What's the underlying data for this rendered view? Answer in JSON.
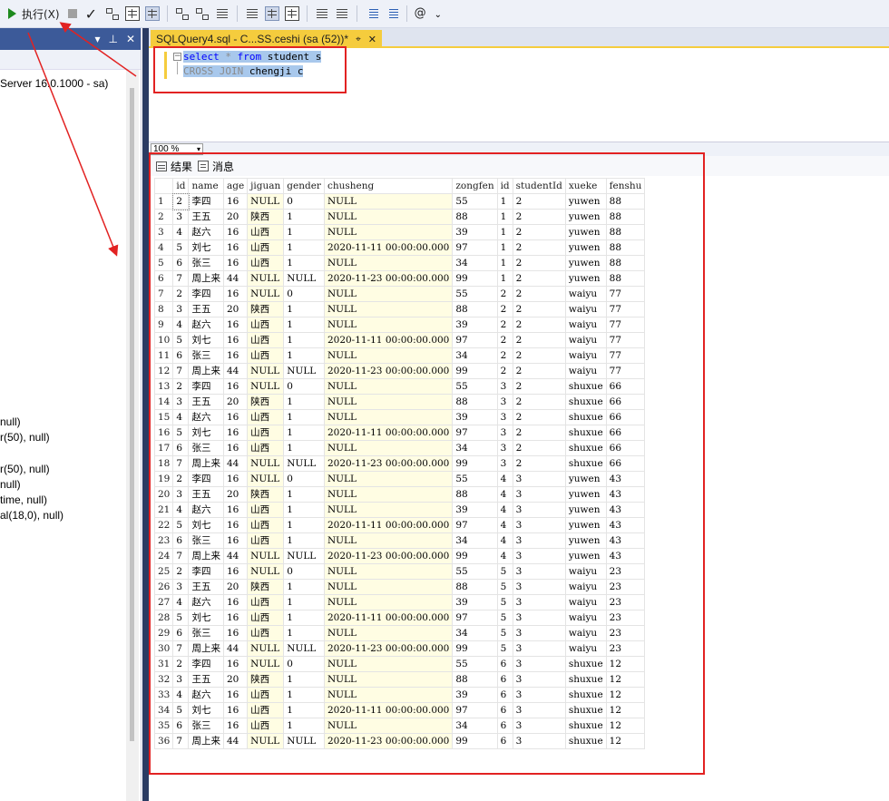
{
  "toolbar": {
    "execute_label": "执行(X)"
  },
  "left_panel": {
    "server_label": "Server 16.0.1000 - sa)",
    "column_fragments": [
      "null)",
      "r(50), null)",
      "r(50), null)",
      " null)",
      "time, null)",
      "al(18,0), null)"
    ]
  },
  "editor": {
    "tab_title": "SQLQuery4.sql - C...SS.ceshi (sa (52))*",
    "tab_pin": "⌖",
    "tab_close": "✕",
    "line1": {
      "kw1": "select",
      "star": " * ",
      "kw2": "from",
      "rest": " student s"
    },
    "line2": {
      "kw": "CROSS JOIN",
      "rest": " chengji c"
    },
    "zoom": "100 %"
  },
  "results": {
    "tab_results": "结果",
    "tab_messages": "消息",
    "columns": [
      "",
      "id",
      "name",
      "age",
      "jiguan",
      "gender",
      "chusheng",
      "zongfen",
      "id",
      "studentId",
      "xueke",
      "fenshu"
    ],
    "rows": [
      [
        "1",
        "2",
        "李四",
        "16",
        "NULL",
        "0",
        "NULL",
        "55",
        "1",
        "2",
        "yuwen",
        "88"
      ],
      [
        "2",
        "3",
        "王五",
        "20",
        "陕西",
        "1",
        "NULL",
        "88",
        "1",
        "2",
        "yuwen",
        "88"
      ],
      [
        "3",
        "4",
        "赵六",
        "16",
        "山西",
        "1",
        "NULL",
        "39",
        "1",
        "2",
        "yuwen",
        "88"
      ],
      [
        "4",
        "5",
        "刘七",
        "16",
        "山西",
        "1",
        "2020-11-11 00:00:00.000",
        "97",
        "1",
        "2",
        "yuwen",
        "88"
      ],
      [
        "5",
        "6",
        "张三",
        "16",
        "山西",
        "1",
        "NULL",
        "34",
        "1",
        "2",
        "yuwen",
        "88"
      ],
      [
        "6",
        "7",
        "周上来",
        "44",
        "NULL",
        "NULL",
        "2020-11-23 00:00:00.000",
        "99",
        "1",
        "2",
        "yuwen",
        "88"
      ],
      [
        "7",
        "2",
        "李四",
        "16",
        "NULL",
        "0",
        "NULL",
        "55",
        "2",
        "2",
        "waiyu",
        "77"
      ],
      [
        "8",
        "3",
        "王五",
        "20",
        "陕西",
        "1",
        "NULL",
        "88",
        "2",
        "2",
        "waiyu",
        "77"
      ],
      [
        "9",
        "4",
        "赵六",
        "16",
        "山西",
        "1",
        "NULL",
        "39",
        "2",
        "2",
        "waiyu",
        "77"
      ],
      [
        "10",
        "5",
        "刘七",
        "16",
        "山西",
        "1",
        "2020-11-11 00:00:00.000",
        "97",
        "2",
        "2",
        "waiyu",
        "77"
      ],
      [
        "11",
        "6",
        "张三",
        "16",
        "山西",
        "1",
        "NULL",
        "34",
        "2",
        "2",
        "waiyu",
        "77"
      ],
      [
        "12",
        "7",
        "周上来",
        "44",
        "NULL",
        "NULL",
        "2020-11-23 00:00:00.000",
        "99",
        "2",
        "2",
        "waiyu",
        "77"
      ],
      [
        "13",
        "2",
        "李四",
        "16",
        "NULL",
        "0",
        "NULL",
        "55",
        "3",
        "2",
        "shuxue",
        "66"
      ],
      [
        "14",
        "3",
        "王五",
        "20",
        "陕西",
        "1",
        "NULL",
        "88",
        "3",
        "2",
        "shuxue",
        "66"
      ],
      [
        "15",
        "4",
        "赵六",
        "16",
        "山西",
        "1",
        "NULL",
        "39",
        "3",
        "2",
        "shuxue",
        "66"
      ],
      [
        "16",
        "5",
        "刘七",
        "16",
        "山西",
        "1",
        "2020-11-11 00:00:00.000",
        "97",
        "3",
        "2",
        "shuxue",
        "66"
      ],
      [
        "17",
        "6",
        "张三",
        "16",
        "山西",
        "1",
        "NULL",
        "34",
        "3",
        "2",
        "shuxue",
        "66"
      ],
      [
        "18",
        "7",
        "周上来",
        "44",
        "NULL",
        "NULL",
        "2020-11-23 00:00:00.000",
        "99",
        "3",
        "2",
        "shuxue",
        "66"
      ],
      [
        "19",
        "2",
        "李四",
        "16",
        "NULL",
        "0",
        "NULL",
        "55",
        "4",
        "3",
        "yuwen",
        "43"
      ],
      [
        "20",
        "3",
        "王五",
        "20",
        "陕西",
        "1",
        "NULL",
        "88",
        "4",
        "3",
        "yuwen",
        "43"
      ],
      [
        "21",
        "4",
        "赵六",
        "16",
        "山西",
        "1",
        "NULL",
        "39",
        "4",
        "3",
        "yuwen",
        "43"
      ],
      [
        "22",
        "5",
        "刘七",
        "16",
        "山西",
        "1",
        "2020-11-11 00:00:00.000",
        "97",
        "4",
        "3",
        "yuwen",
        "43"
      ],
      [
        "23",
        "6",
        "张三",
        "16",
        "山西",
        "1",
        "NULL",
        "34",
        "4",
        "3",
        "yuwen",
        "43"
      ],
      [
        "24",
        "7",
        "周上来",
        "44",
        "NULL",
        "NULL",
        "2020-11-23 00:00:00.000",
        "99",
        "4",
        "3",
        "yuwen",
        "43"
      ],
      [
        "25",
        "2",
        "李四",
        "16",
        "NULL",
        "0",
        "NULL",
        "55",
        "5",
        "3",
        "waiyu",
        "23"
      ],
      [
        "26",
        "3",
        "王五",
        "20",
        "陕西",
        "1",
        "NULL",
        "88",
        "5",
        "3",
        "waiyu",
        "23"
      ],
      [
        "27",
        "4",
        "赵六",
        "16",
        "山西",
        "1",
        "NULL",
        "39",
        "5",
        "3",
        "waiyu",
        "23"
      ],
      [
        "28",
        "5",
        "刘七",
        "16",
        "山西",
        "1",
        "2020-11-11 00:00:00.000",
        "97",
        "5",
        "3",
        "waiyu",
        "23"
      ],
      [
        "29",
        "6",
        "张三",
        "16",
        "山西",
        "1",
        "NULL",
        "34",
        "5",
        "3",
        "waiyu",
        "23"
      ],
      [
        "30",
        "7",
        "周上来",
        "44",
        "NULL",
        "NULL",
        "2020-11-23 00:00:00.000",
        "99",
        "5",
        "3",
        "waiyu",
        "23"
      ],
      [
        "31",
        "2",
        "李四",
        "16",
        "NULL",
        "0",
        "NULL",
        "55",
        "6",
        "3",
        "shuxue",
        "12"
      ],
      [
        "32",
        "3",
        "王五",
        "20",
        "陕西",
        "1",
        "NULL",
        "88",
        "6",
        "3",
        "shuxue",
        "12"
      ],
      [
        "33",
        "4",
        "赵六",
        "16",
        "山西",
        "1",
        "NULL",
        "39",
        "6",
        "3",
        "shuxue",
        "12"
      ],
      [
        "34",
        "5",
        "刘七",
        "16",
        "山西",
        "1",
        "2020-11-11 00:00:00.000",
        "97",
        "6",
        "3",
        "shuxue",
        "12"
      ],
      [
        "35",
        "6",
        "张三",
        "16",
        "山西",
        "1",
        "NULL",
        "34",
        "6",
        "3",
        "shuxue",
        "12"
      ],
      [
        "36",
        "7",
        "周上来",
        "44",
        "NULL",
        "NULL",
        "2020-11-23 00:00:00.000",
        "99",
        "6",
        "3",
        "shuxue",
        "12"
      ]
    ]
  },
  "colors": {
    "annotation_red": "#e22222",
    "tab_yellow": "#f5cc3d",
    "null_bg": "#fffde3",
    "selection": "#a8c8ec"
  }
}
